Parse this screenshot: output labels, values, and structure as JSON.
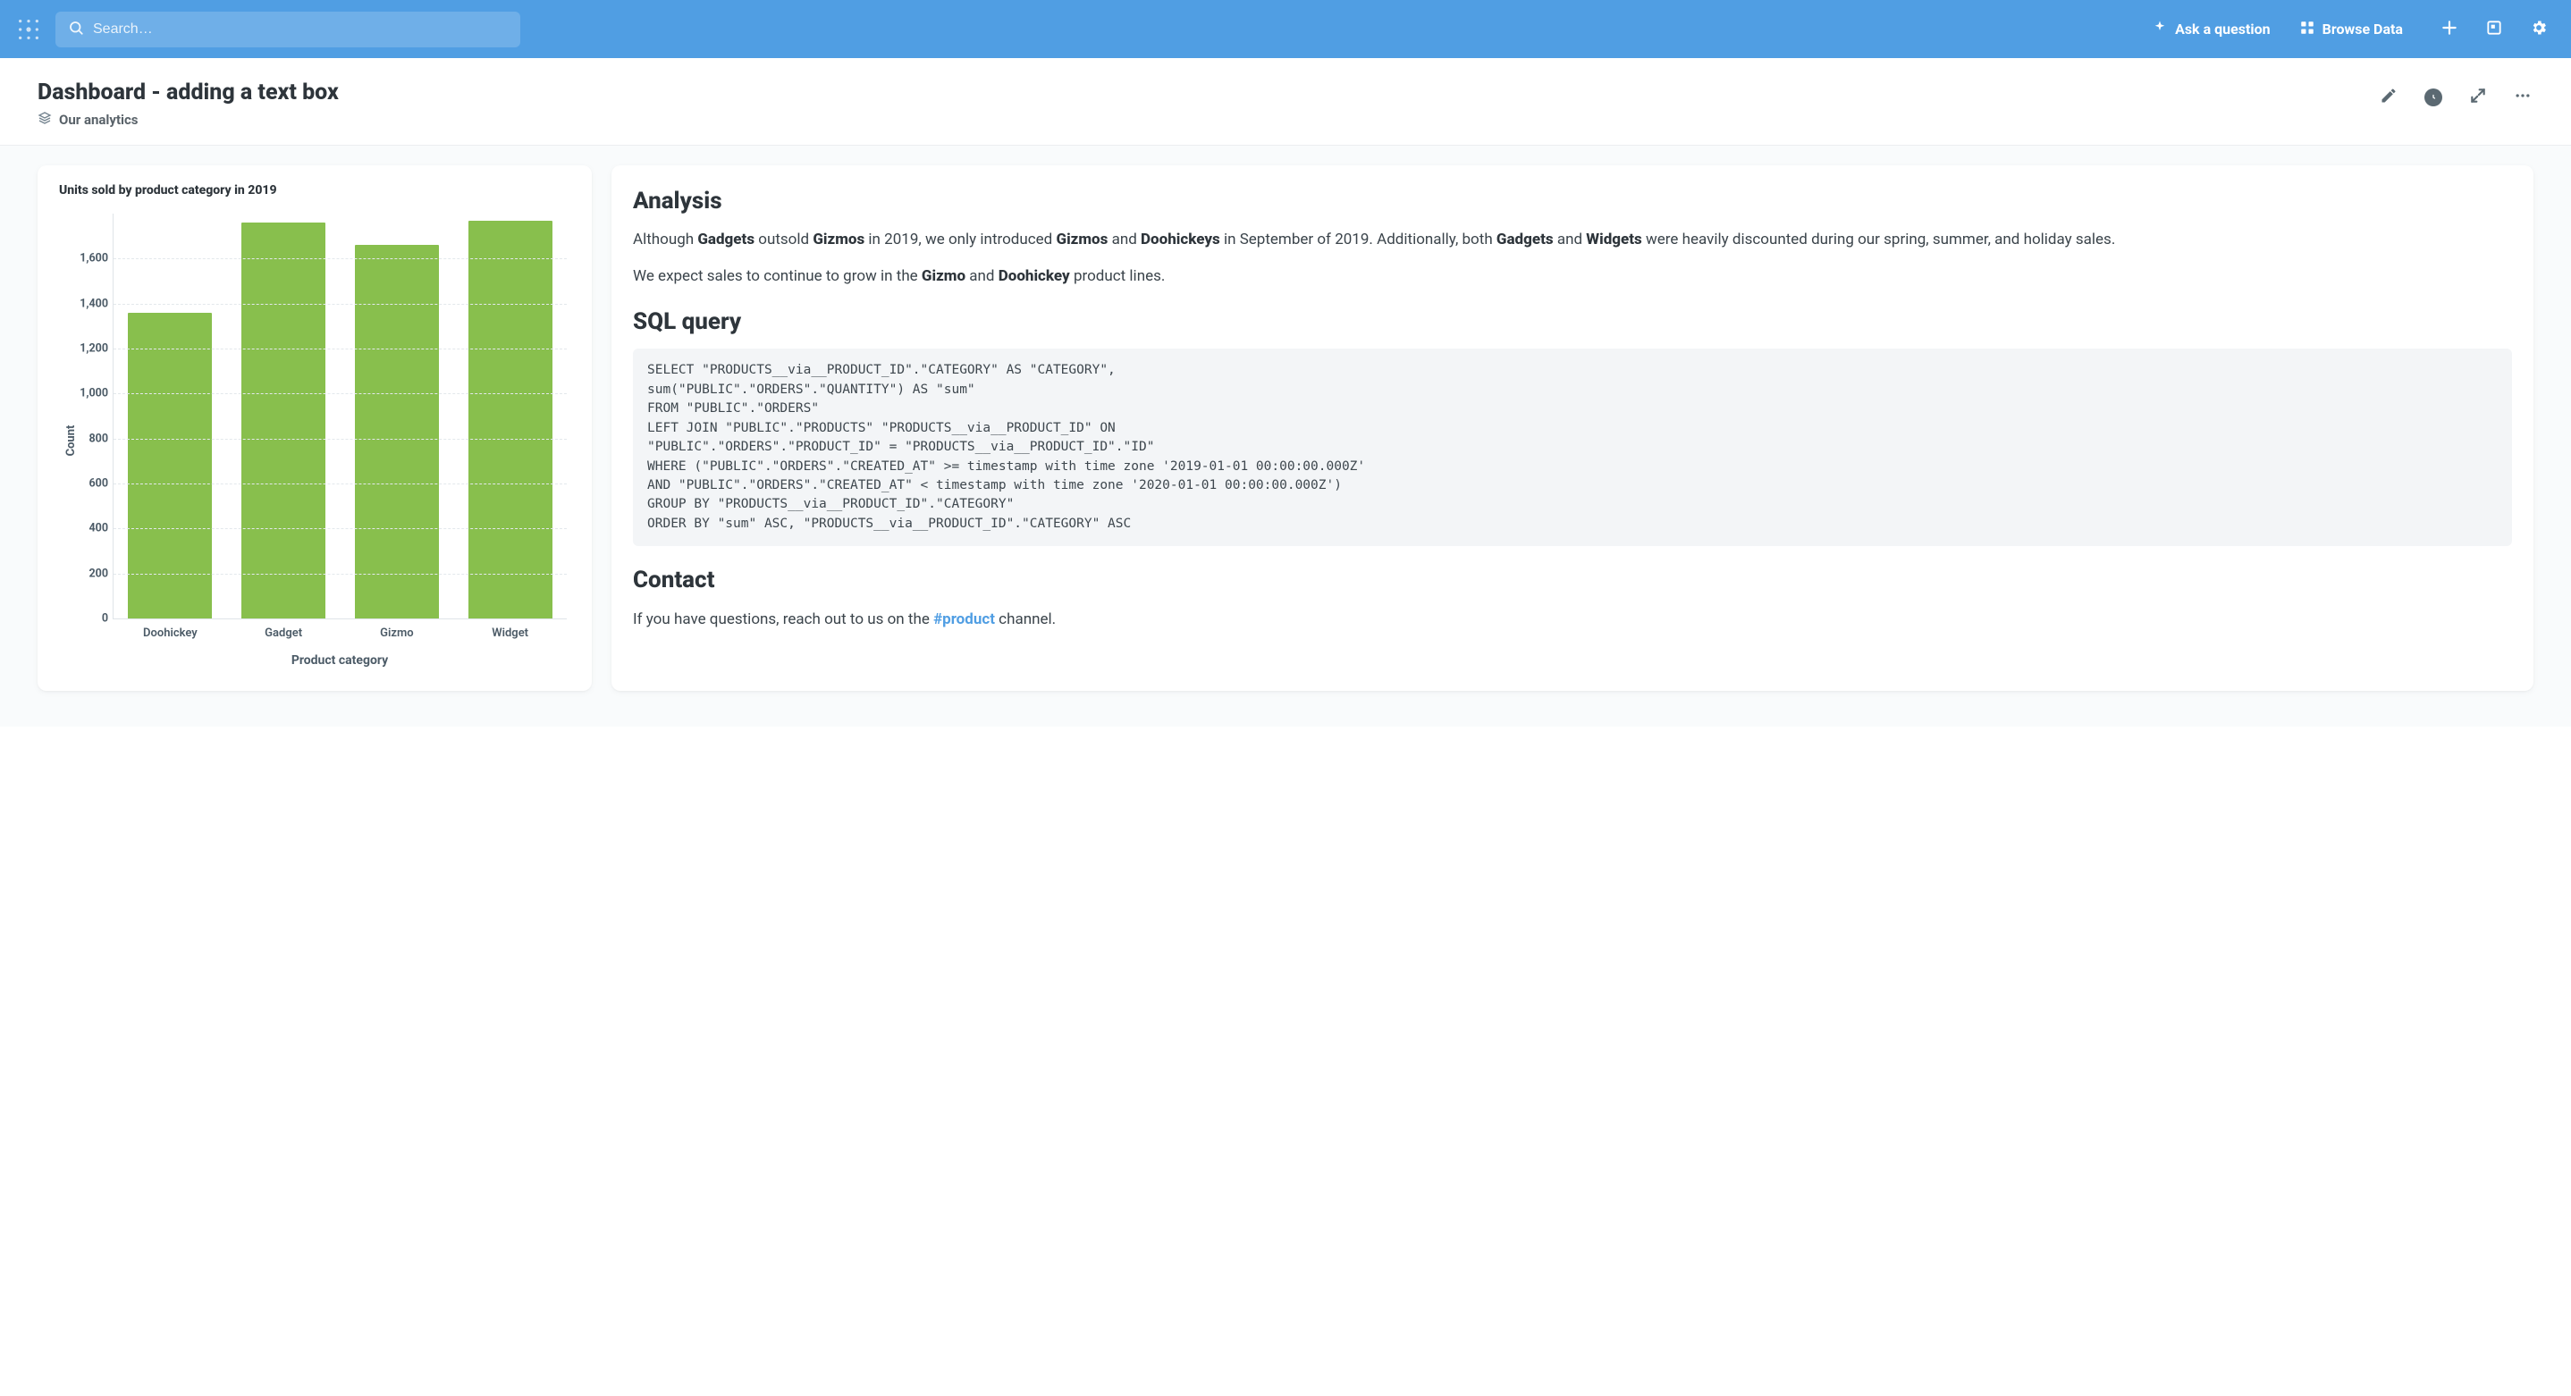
{
  "topbar": {
    "search_placeholder": "Search…",
    "ask_label": "Ask a question",
    "browse_label": "Browse Data"
  },
  "header": {
    "title": "Dashboard - adding a text box",
    "collection": "Our analytics"
  },
  "chart_card": {
    "title": "Units sold by product category in 2019"
  },
  "chart_data": {
    "type": "bar",
    "title": "Units sold by product category in 2019",
    "xlabel": "Product category",
    "ylabel": "Count",
    "categories": [
      "Doohickey",
      "Gadget",
      "Gizmo",
      "Widget"
    ],
    "values": [
      1360,
      1760,
      1660,
      1770
    ],
    "ylim": [
      0,
      1800
    ],
    "y_ticks": [
      0,
      200,
      400,
      600,
      800,
      1000,
      1200,
      1400,
      1600
    ]
  },
  "text_card": {
    "analysis_heading": "Analysis",
    "p1": {
      "t0": "Although ",
      "b0": "Gadgets",
      "t1": " outsold ",
      "b1": "Gizmos",
      "t2": " in 2019, we only introduced ",
      "b2": "Gizmos",
      "t3": " and ",
      "b3": "Doohickeys",
      "t4": " in September of 2019. Additionally, both ",
      "b4": "Gadgets",
      "t5": " and ",
      "b5": "Widgets",
      "t6": " were heavily discounted during our spring, summer, and holiday sales."
    },
    "p2": {
      "t0": "We expect sales to continue to grow in the ",
      "b0": "Gizmo",
      "t1": " and ",
      "b1": "Doohickey",
      "t2": " product lines."
    },
    "sql_heading": "SQL query",
    "sql": "SELECT \"PRODUCTS__via__PRODUCT_ID\".\"CATEGORY\" AS \"CATEGORY\",\nsum(\"PUBLIC\".\"ORDERS\".\"QUANTITY\") AS \"sum\"\nFROM \"PUBLIC\".\"ORDERS\"\nLEFT JOIN \"PUBLIC\".\"PRODUCTS\" \"PRODUCTS__via__PRODUCT_ID\" ON\n\"PUBLIC\".\"ORDERS\".\"PRODUCT_ID\" = \"PRODUCTS__via__PRODUCT_ID\".\"ID\"\nWHERE (\"PUBLIC\".\"ORDERS\".\"CREATED_AT\" >= timestamp with time zone '2019-01-01 00:00:00.000Z'\nAND \"PUBLIC\".\"ORDERS\".\"CREATED_AT\" < timestamp with time zone '2020-01-01 00:00:00.000Z')\nGROUP BY \"PRODUCTS__via__PRODUCT_ID\".\"CATEGORY\"\nORDER BY \"sum\" ASC, \"PRODUCTS__via__PRODUCT_ID\".\"CATEGORY\" ASC",
    "contact_heading": "Contact",
    "contact": {
      "t0": "If you have questions, reach out to us on the ",
      "link": "#product",
      "t1": " channel."
    }
  }
}
